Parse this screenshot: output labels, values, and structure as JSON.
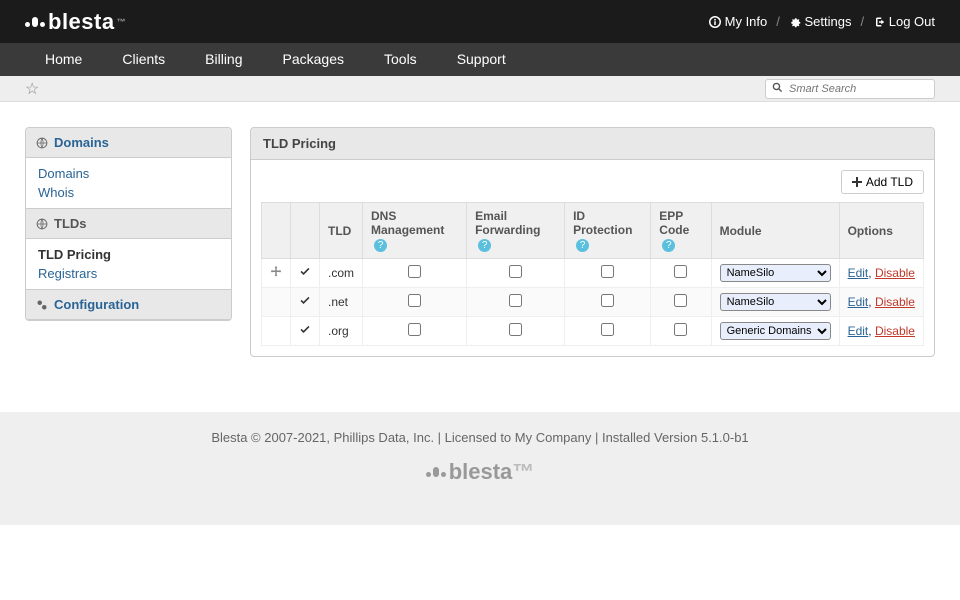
{
  "topbar": {
    "my_info": "My Info",
    "settings": "Settings",
    "logout": "Log Out"
  },
  "logo_text": "blesta",
  "nav": [
    "Home",
    "Clients",
    "Billing",
    "Packages",
    "Tools",
    "Support"
  ],
  "search": {
    "placeholder": "Smart Search"
  },
  "sidebar": {
    "domains": {
      "title": "Domains",
      "items": [
        "Domains",
        "Whois"
      ]
    },
    "tlds": {
      "title": "TLDs",
      "active": "TLD Pricing",
      "items": [
        "Registrars"
      ]
    },
    "config": {
      "title": "Configuration"
    }
  },
  "panel": {
    "title": "TLD Pricing",
    "add_btn": "Add TLD",
    "columns": {
      "tld": "TLD",
      "dns": "DNS Management",
      "email": "Email Forwarding",
      "idp": "ID Protection",
      "epp": "EPP Code",
      "module": "Module",
      "options": "Options"
    },
    "rows": [
      {
        "tld": ".com",
        "module": "NameSilo",
        "draggable": true
      },
      {
        "tld": ".net",
        "module": "NameSilo",
        "draggable": false
      },
      {
        "tld": ".org",
        "module": "Generic Domains",
        "draggable": false
      }
    ],
    "module_options": [
      "NameSilo",
      "Generic Domains"
    ],
    "edit_label": "Edit",
    "disable_label": "Disable"
  },
  "footer": {
    "text": "Blesta © 2007-2021, Phillips Data, Inc. | Licensed to My Company | Installed Version 5.1.0-b1"
  }
}
